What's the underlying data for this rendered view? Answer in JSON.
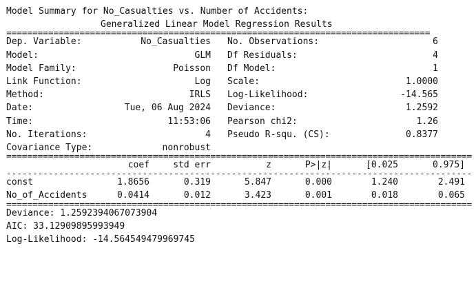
{
  "heading": {
    "line1": "Model Summary for No_Casualties vs. Number of Accidents:",
    "line2": "Generalized Linear Model Regression Results"
  },
  "rules": {
    "double_short": "=================================================================================",
    "double_long": "=========================================================================================",
    "dash_long": "-----------------------------------------------------------------------------------------"
  },
  "info_left": [
    {
      "label": "Dep. Variable:",
      "value": "No_Casualties"
    },
    {
      "label": "Model:",
      "value": "GLM"
    },
    {
      "label": "Model Family:",
      "value": "Poisson"
    },
    {
      "label": "Link Function:",
      "value": "Log"
    },
    {
      "label": "Method:",
      "value": "IRLS"
    },
    {
      "label": "Date:",
      "value": "Tue, 06 Aug 2024"
    },
    {
      "label": "Time:",
      "value": "11:53:06"
    },
    {
      "label": "No. Iterations:",
      "value": "4"
    },
    {
      "label": "Covariance Type:",
      "value": "nonrobust"
    }
  ],
  "info_right": [
    {
      "label": "No. Observations:",
      "value": "6"
    },
    {
      "label": "Df Residuals:",
      "value": "4"
    },
    {
      "label": "Df Model:",
      "value": "1"
    },
    {
      "label": "Scale:",
      "value": "1.0000"
    },
    {
      "label": "Log-Likelihood:",
      "value": "-14.565"
    },
    {
      "label": "Deviance:",
      "value": "1.2592"
    },
    {
      "label": "Pearson chi2:",
      "value": "1.26"
    },
    {
      "label": "Pseudo R-squ. (CS):",
      "value": "0.8377"
    }
  ],
  "coef_table": {
    "headers": [
      "coef",
      "std err",
      "z",
      "P>|z|",
      "[0.025",
      "0.975]"
    ],
    "rows": [
      {
        "name": "const",
        "values": [
          "1.8656",
          "0.319",
          "5.847",
          "0.000",
          "1.240",
          "2.491"
        ]
      },
      {
        "name": "No_of_Accidents",
        "values": [
          "0.0414",
          "0.012",
          "3.423",
          "0.001",
          "0.018",
          "0.065"
        ]
      }
    ]
  },
  "footer": {
    "deviance": "Deviance: 1.2592394067073904",
    "aic": "AIC: 33.12909895993949",
    "loglik": "Log-Likelihood: -14.564549479969745"
  }
}
